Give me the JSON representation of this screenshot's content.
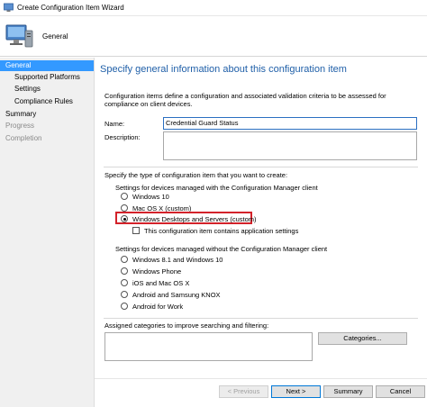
{
  "window": {
    "title": "Create Configuration Item Wizard"
  },
  "header": {
    "page_name": "General"
  },
  "nav": {
    "items": [
      {
        "label": "General",
        "state": "selected"
      },
      {
        "label": "Supported Platforms",
        "state": "normal"
      },
      {
        "label": "Settings",
        "state": "normal"
      },
      {
        "label": "Compliance Rules",
        "state": "normal"
      },
      {
        "label": "Summary",
        "state": "normal"
      },
      {
        "label": "Progress",
        "state": "disabled"
      },
      {
        "label": "Completion",
        "state": "disabled"
      }
    ]
  },
  "main": {
    "heading": "Specify general information about this configuration item",
    "intro": "Configuration items define a configuration and associated validation criteria to be assessed for compliance on client devices.",
    "name_label": "Name:",
    "name_value": "Credential Guard Status",
    "description_label": "Description:",
    "description_value": "",
    "type_prompt": "Specify the type of configuration item that you want to create:",
    "managed_label": "Settings for devices managed with the Configuration Manager client",
    "managed_options": [
      "Windows 10",
      "Mac OS X (custom)",
      "Windows Desktops and Servers (custom)"
    ],
    "managed_selected": "Windows Desktops and Servers (custom)",
    "app_settings_label": "This configuration item contains application settings",
    "app_settings_checked": false,
    "unmanaged_label": "Settings for devices managed without the Configuration Manager client",
    "unmanaged_options": [
      "Windows 8.1 and Windows 10",
      "Windows Phone",
      "iOS and Mac OS X",
      "Android and Samsung KNOX",
      "Android for Work"
    ],
    "categories_label": "Assigned categories to improve searching and filtering:",
    "categories_button": "Categories..."
  },
  "footer": {
    "previous_label": "< Previous",
    "next_label": "Next >",
    "summary_label": "Summary",
    "cancel_label": "Cancel"
  },
  "colors": {
    "accent": "#3399ff",
    "heading": "#1f5fa8",
    "highlight_box": "#d3222a"
  }
}
